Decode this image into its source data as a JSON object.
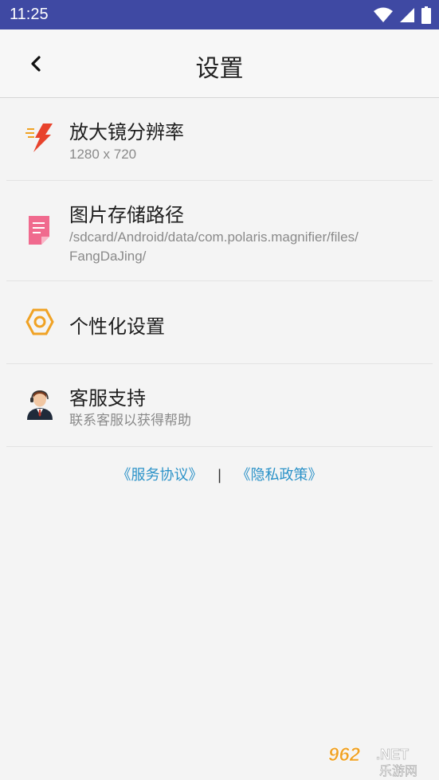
{
  "status_bar": {
    "time": "11:25"
  },
  "header": {
    "title": "设置"
  },
  "settings": {
    "items": [
      {
        "title": "放大镜分辨率",
        "subtitle": "1280 x 720"
      },
      {
        "title": "图片存储路径",
        "subtitle_line1": "/sdcard/Android/data/com.polaris.magnifier/files/",
        "subtitle_line2": "FangDaJing/"
      },
      {
        "title": "个性化设置"
      },
      {
        "title": "客服支持",
        "subtitle": "联系客服以获得帮助"
      }
    ]
  },
  "footer": {
    "service_agreement": "《服务协议》",
    "separator": "|",
    "privacy_policy": "《隐私政策》"
  },
  "watermark": {
    "text_top": "962.NET",
    "text_bottom": "乐游网"
  },
  "colors": {
    "status_bar": "#3f49a3",
    "link": "#2b92c8",
    "icon_orange": "#f0a224",
    "icon_pink": "#f06a8e",
    "icon_red": "#e8432c"
  }
}
